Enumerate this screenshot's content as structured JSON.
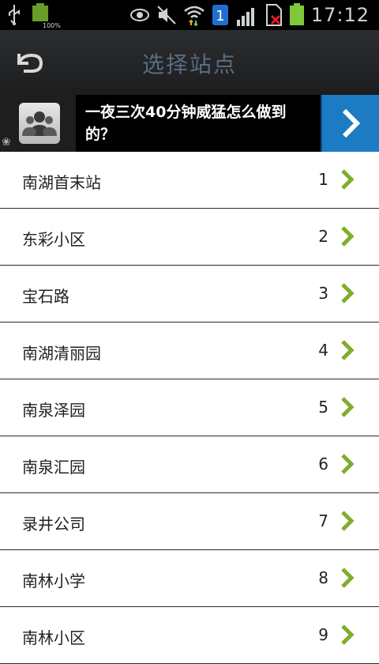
{
  "status_bar": {
    "time": "17:12",
    "battery_label": "100%",
    "notification_badge": "1"
  },
  "header": {
    "title": "选择站点",
    "back_icon": "back-arrow-icon"
  },
  "ad": {
    "text": "一夜三次40分钟威猛怎么做到的？",
    "icon": "group-people-icon",
    "arrow_icon": "chevron-right-icon"
  },
  "colors": {
    "accent": "#1d7bc4",
    "chevron": "#7fae2a",
    "title": "#5a6c80"
  },
  "stations": [
    {
      "name": "南湖首末站",
      "number": "1"
    },
    {
      "name": "东彩小区",
      "number": "2"
    },
    {
      "name": "宝石路",
      "number": "3"
    },
    {
      "name": "南湖清丽园",
      "number": "4"
    },
    {
      "name": "南泉泽园",
      "number": "5"
    },
    {
      "name": "南泉汇园",
      "number": "6"
    },
    {
      "name": "录井公司",
      "number": "7"
    },
    {
      "name": "南林小学",
      "number": "8"
    },
    {
      "name": "南林小区",
      "number": "9"
    }
  ]
}
